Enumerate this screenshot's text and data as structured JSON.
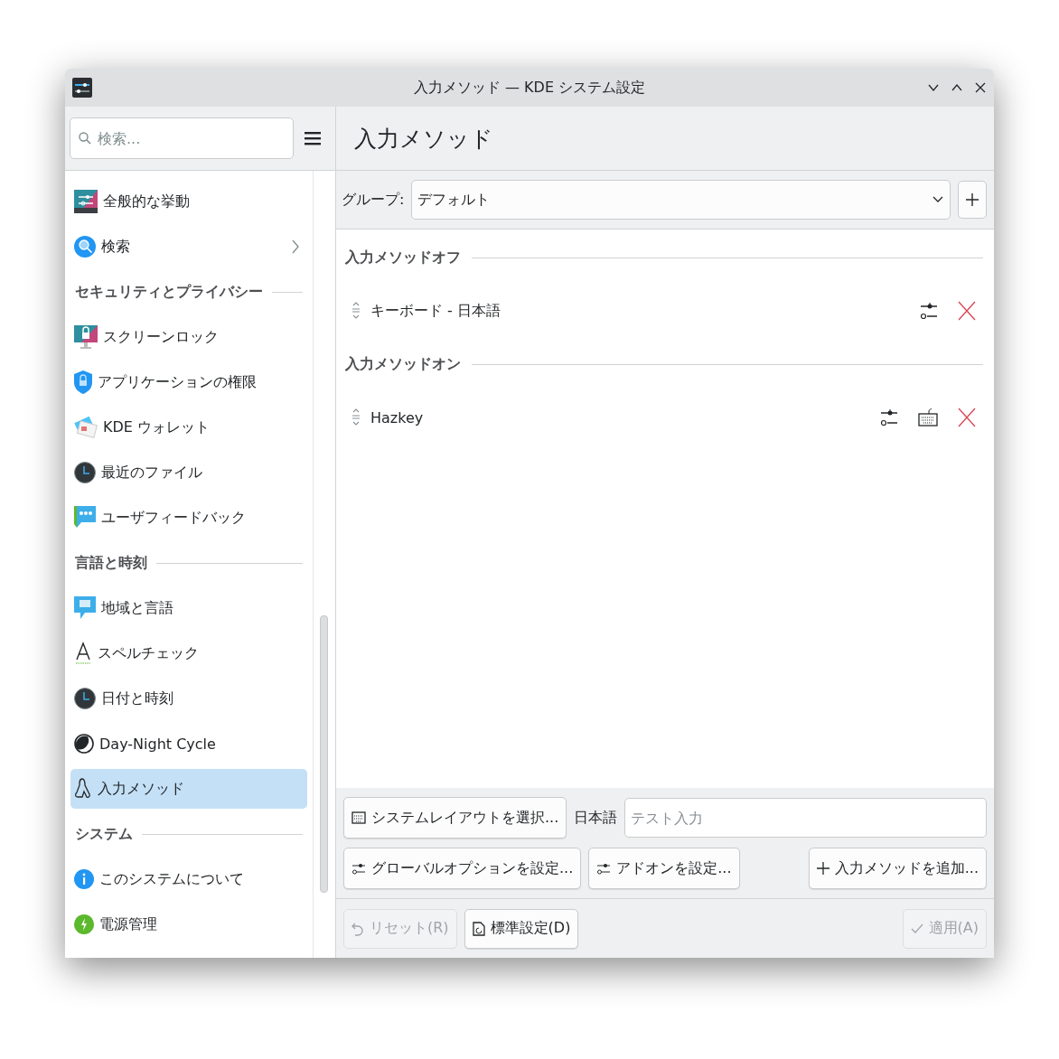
{
  "window": {
    "title": "入力メソッド — KDE システム設定"
  },
  "search": {
    "placeholder": "検索..."
  },
  "page_title": "入力メソッド",
  "sidebar": {
    "items": [
      {
        "kind": "item",
        "label": "全般的な挙動",
        "selected": false,
        "expandable": false
      },
      {
        "kind": "item",
        "label": "検索",
        "selected": false,
        "expandable": true
      },
      {
        "kind": "header",
        "label": "セキュリティとプライバシー"
      },
      {
        "kind": "item",
        "label": "スクリーンロック",
        "selected": false,
        "expandable": false
      },
      {
        "kind": "item",
        "label": "アプリケーションの権限",
        "selected": false,
        "expandable": false
      },
      {
        "kind": "item",
        "label": "KDE ウォレット",
        "selected": false,
        "expandable": false
      },
      {
        "kind": "item",
        "label": "最近のファイル",
        "selected": false,
        "expandable": false
      },
      {
        "kind": "item",
        "label": "ユーザフィードバック",
        "selected": false,
        "expandable": false
      },
      {
        "kind": "header",
        "label": "言語と時刻"
      },
      {
        "kind": "item",
        "label": "地域と言語",
        "selected": false,
        "expandable": false
      },
      {
        "kind": "item",
        "label": "スペルチェック",
        "selected": false,
        "expandable": false
      },
      {
        "kind": "item",
        "label": "日付と時刻",
        "selected": false,
        "expandable": false
      },
      {
        "kind": "item",
        "label": "Day-Night Cycle",
        "selected": false,
        "expandable": false
      },
      {
        "kind": "item",
        "label": "入力メソッド",
        "selected": true,
        "expandable": false
      },
      {
        "kind": "header",
        "label": "システム"
      },
      {
        "kind": "item",
        "label": "このシステムについて",
        "selected": false,
        "expandable": false
      },
      {
        "kind": "item",
        "label": "電源管理",
        "selected": false,
        "expandable": false
      }
    ]
  },
  "group": {
    "label": "グループ:",
    "value": "デフォルト"
  },
  "sections": [
    {
      "title": "入力メソッドオフ",
      "methods": [
        {
          "name": "キーボード - 日本語",
          "layout_button": false
        }
      ]
    },
    {
      "title": "入力メソッドオン",
      "methods": [
        {
          "name": "Hazkey",
          "layout_button": true
        }
      ]
    }
  ],
  "test": {
    "layout_button": "システムレイアウトを選択...",
    "language": "日本語",
    "placeholder": "テスト入力"
  },
  "actions": {
    "global_options": "グローバルオプションを設定...",
    "addons": "アドオンを設定...",
    "add": "入力メソッドを追加..."
  },
  "footer": [
    {
      "kind": "reset",
      "label": "リセット(R)",
      "disabled": true
    },
    {
      "kind": "defaults",
      "label": "標準設定(D)",
      "disabled": false
    },
    {
      "kind": "apply",
      "label": "適用(A)",
      "disabled": true
    }
  ]
}
